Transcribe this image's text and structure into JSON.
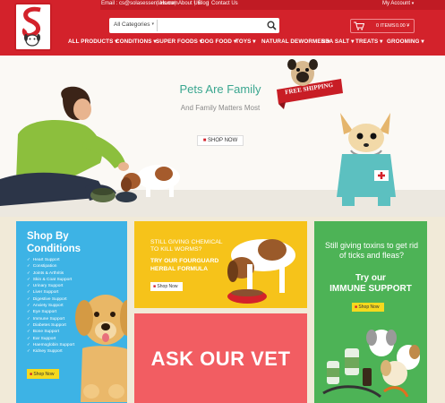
{
  "header": {
    "top_links": {
      "email": "Email : cs@solasessentials.com",
      "home": "Home",
      "about": "About Us",
      "blog": "Blog",
      "contact": "Contact Us",
      "account": "My Account"
    },
    "search": {
      "category": "All Categories",
      "placeholder": ""
    },
    "cart": {
      "items": "0 ITEMS",
      "total": "0.00 ¥"
    },
    "nav": [
      "ALL PRODUCTS",
      "CONDITIONS",
      "SUPER FOODS",
      "DOG FOOD",
      "TOYS",
      "NATURAL DEWORMER",
      "SEA SALT",
      "TREATS",
      "GROOMING"
    ]
  },
  "hero": {
    "title": "Pets Are Family",
    "subtitle": "And Family Matters Most",
    "button_label": "SHOP NOW",
    "badge_text": "FREE SHIPPING"
  },
  "tiles": {
    "conditions": {
      "title_line1": "Shop By",
      "title_line2": "Conditions",
      "items": [
        "Heart Support",
        "Constipation",
        "Joints & Arthritis",
        "Skin & Coat Support",
        "Urinary Support",
        "Liver Support",
        "Digestive Support",
        "Anxiety Support",
        "Eye Support",
        "Immune Support",
        "Diabetes Support",
        "Bone Support",
        "Ear Support",
        "Haemoglobin Support",
        "Kidney Support"
      ],
      "button_label": "Shop Now"
    },
    "worms": {
      "line1": "STILL GIVING CHEMICAL",
      "line2": "TO KILL WORMS?",
      "line3": "TRY OUR FOURGUARD",
      "line4": "HERBAL FORMULA",
      "button_label": "Shop Now"
    },
    "vet": {
      "title": "ASK OUR VET"
    },
    "immune": {
      "question": "Still giving toxins to get rid of ticks and fleas?",
      "try_line": "Try our",
      "product_line": "IMMUNE SUPPORT",
      "button_label": "Shop Now"
    }
  },
  "colors": {
    "brand_red": "#d3222b",
    "conditions_blue": "#3db3e5",
    "worms_yellow": "#f6c31a",
    "vet_pink": "#f25d62",
    "immune_green": "#4db356",
    "hero_teal": "#3aa68f"
  }
}
